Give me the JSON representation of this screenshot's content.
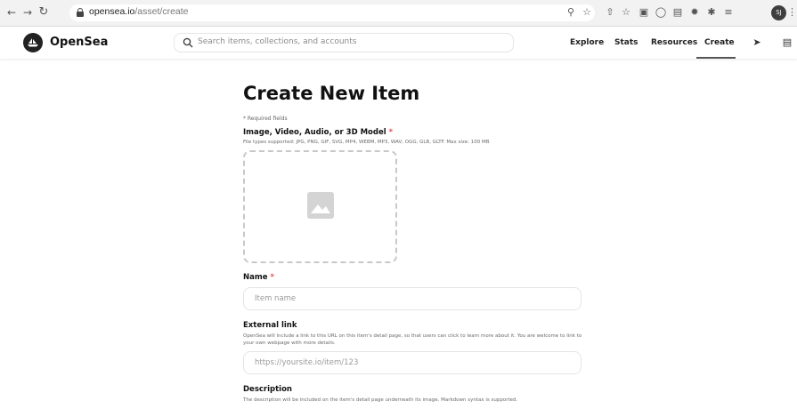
{
  "browser": {
    "url_host": "opensea.io",
    "url_path": "/asset/create",
    "profile_initials": "SJ"
  },
  "header": {
    "brand": "OpenSea",
    "search_placeholder": "Search items, collections, and accounts",
    "nav": [
      "Explore",
      "Stats",
      "Resources",
      "Create"
    ],
    "active_nav": "Create"
  },
  "form": {
    "title": "Create New Item",
    "required_note": "* Required fields",
    "media": {
      "label": "Image, Video, Audio, or 3D Model",
      "required_mark": "*",
      "hint": "File types supported: JPG, PNG, GIF, SVG, MP4, WEBM, MP3, WAV, OGG, GLB, GLTF. Max size: 100 MB"
    },
    "name": {
      "label": "Name",
      "required_mark": "*",
      "placeholder": "Item name"
    },
    "external_link": {
      "label": "External link",
      "hint": "OpenSea will include a link to this URL on this item's detail page, so that users can click to learn more about it. You are welcome to link to your own webpage with more details.",
      "placeholder": "https://yoursite.io/item/123"
    },
    "description": {
      "label": "Description",
      "hint": "The description will be included on the item's detail page underneath its image. Markdown syntax is supported."
    }
  },
  "colors": {
    "required_star": "#e24d4d",
    "nav_active_underline": "#555555"
  }
}
